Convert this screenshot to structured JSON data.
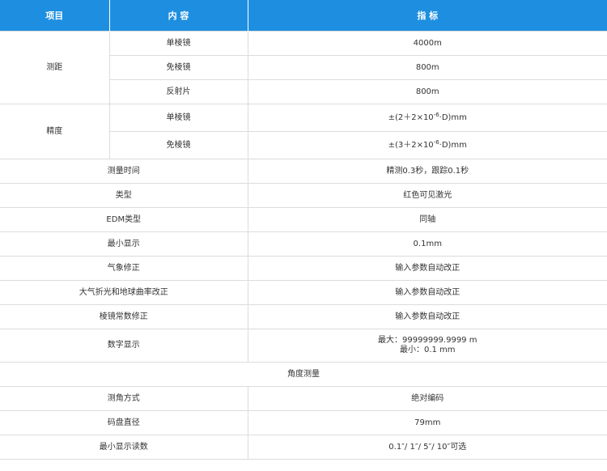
{
  "header": {
    "col1": "项目",
    "col2": "内 容",
    "col3": "指 标"
  },
  "ranging": {
    "label": "测距",
    "rows": [
      {
        "content": "单棱镜",
        "spec": "4000m"
      },
      {
        "content": "免棱镜",
        "spec": "800m"
      },
      {
        "content": "反射片",
        "spec": "800m"
      }
    ]
  },
  "accuracy": {
    "label": "精度",
    "rows": [
      {
        "content": "单棱镜",
        "spec_pre": "±(2＋2×10",
        "spec_exp": "-6",
        "spec_post": "·D)mm"
      },
      {
        "content": "免棱镜",
        "spec_pre": "±(3＋2×10",
        "spec_exp": "-6",
        "spec_post": "·D)mm"
      }
    ]
  },
  "rows": [
    {
      "item": "测量时间",
      "spec": "精测0.3秒，跟踪0.1秒"
    },
    {
      "item": "类型",
      "spec": "红色可见激光"
    },
    {
      "item": "EDM类型",
      "spec": "同轴"
    },
    {
      "item": "最小显示",
      "spec": "0.1mm"
    },
    {
      "item": "气象修正",
      "spec": "输入参数自动改正"
    },
    {
      "item": "大气折光和地球曲率改正",
      "spec": "输入参数自动改正"
    },
    {
      "item": "棱镜常数修正",
      "spec": "输入参数自动改正"
    }
  ],
  "digital_display": {
    "item": "数字显示",
    "line1": "最大：99999999.9999 m",
    "line2": "最小：0.1 mm"
  },
  "section": {
    "title": "角度测量"
  },
  "angle_rows": [
    {
      "item": "测角方式",
      "spec": "绝对编码"
    },
    {
      "item": "码盘直径",
      "spec": "79mm"
    },
    {
      "item": "最小显示读数",
      "spec": "0.1″/ 1″/ 5″/ 10″可选"
    }
  ],
  "colors": {
    "header_bg": "#1e8fe0",
    "header_text": "#ffffff",
    "border": "#dcdcdc",
    "text": "#333333"
  }
}
